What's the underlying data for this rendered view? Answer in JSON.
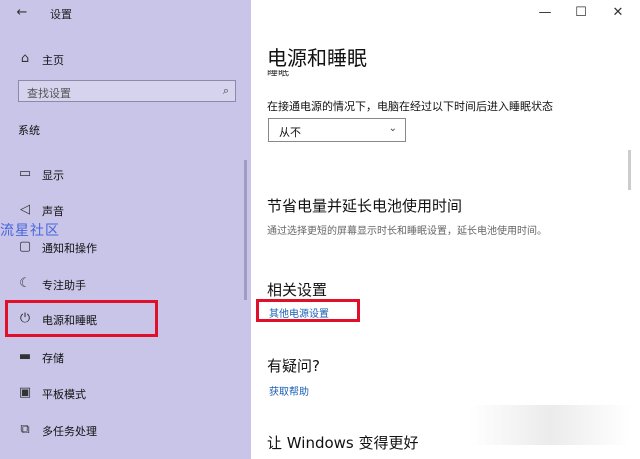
{
  "window": {
    "title": "设置",
    "back_icon": "back-arrow-icon",
    "minimize_icon": "minimize-icon",
    "maximize_icon": "maximize-icon",
    "close_icon": "close-icon"
  },
  "sidebar": {
    "home_label": "主页",
    "search_placeholder": "查找设置",
    "section_label": "系统",
    "watermark": "流星社区",
    "items": [
      {
        "label": "显示",
        "icon": "monitor-icon"
      },
      {
        "label": "声音",
        "icon": "speaker-icon"
      },
      {
        "label": "通知和操作",
        "icon": "notification-icon"
      },
      {
        "label": "专注助手",
        "icon": "moon-icon"
      },
      {
        "label": "电源和睡眠",
        "icon": "power-icon"
      },
      {
        "label": "存储",
        "icon": "storage-icon"
      },
      {
        "label": "平板模式",
        "icon": "tablet-icon"
      },
      {
        "label": "多任务处理",
        "icon": "multitask-icon"
      }
    ],
    "highlight_color": "#e0102a"
  },
  "main": {
    "title": "电源和睡眠",
    "subtitle_cut": "睡眠",
    "sleep_desc": "在接通电源的情况下，电脑在经过以下时间后进入睡眠状态",
    "sleep_select_value": "从不",
    "save_title": "节省电量并延长电池使用时间",
    "save_desc": "通过选择更短的屏幕显示时长和睡眠设置，延长电池使用时间。",
    "related_title": "相关设置",
    "related_link": "其他电源设置",
    "question_title": "有疑问?",
    "help_link": "获取帮助",
    "better_title": "让 Windows 变得更好",
    "link_color": "#1a5fb4"
  }
}
